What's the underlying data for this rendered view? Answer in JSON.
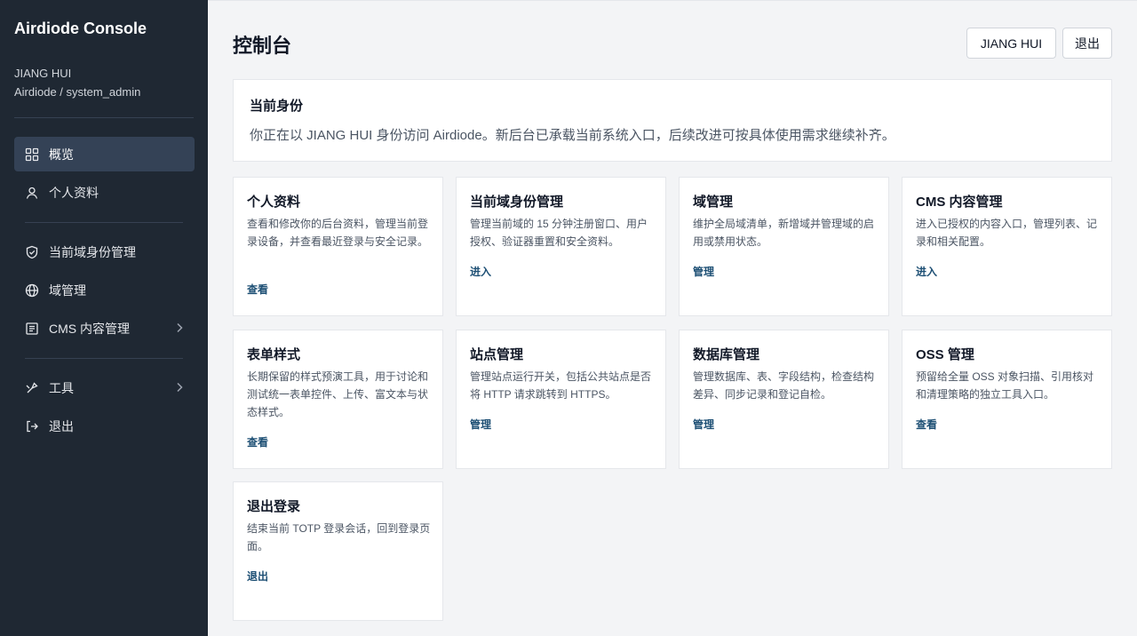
{
  "sidebar": {
    "brand": "Airdiode Console",
    "user_name": "JIANG HUI",
    "user_role": "Airdiode / system_admin",
    "items": [
      {
        "label": "概览",
        "icon": "grid-icon"
      },
      {
        "label": "个人资料",
        "icon": "user-icon"
      },
      {
        "label": "当前域身份管理",
        "icon": "shield-check-icon"
      },
      {
        "label": "域管理",
        "icon": "globe-icon"
      },
      {
        "label": "CMS 内容管理",
        "icon": "document-list-icon"
      },
      {
        "label": "工具",
        "icon": "tools-icon"
      },
      {
        "label": "退出",
        "icon": "logout-icon"
      }
    ]
  },
  "header": {
    "title": "控制台",
    "user_button": "JIANG HUI",
    "logout_button": "退出"
  },
  "identity": {
    "title": "当前身份",
    "text": "你正在以 JIANG HUI 身份访问 Airdiode。新后台已承载当前系统入口，后续改进可按具体使用需求继续补齐。"
  },
  "cards": [
    {
      "title": "个人资料",
      "desc": "查看和修改你的后台资料，管理当前登录设备，并查看最近登录与安全记录。",
      "link": "查看"
    },
    {
      "title": "当前域身份管理",
      "desc": "管理当前域的 15 分钟注册窗口、用户授权、验证器重置和安全资料。",
      "link": "进入"
    },
    {
      "title": "域管理",
      "desc": "维护全局域清单，新增域并管理域的启用或禁用状态。",
      "link": "管理"
    },
    {
      "title": "CMS 内容管理",
      "desc": "进入已授权的内容入口，管理列表、记录和相关配置。",
      "link": "进入"
    },
    {
      "title": "表单样式",
      "desc": "长期保留的样式预演工具，用于讨论和测试统一表单控件、上传、富文本与状态样式。",
      "link": "查看"
    },
    {
      "title": "站点管理",
      "desc": "管理站点运行开关，包括公共站点是否将 HTTP 请求跳转到 HTTPS。",
      "link": "管理"
    },
    {
      "title": "数据库管理",
      "desc": "管理数据库、表、字段结构，检查结构差异、同步记录和登记自检。",
      "link": "管理"
    },
    {
      "title": "OSS 管理",
      "desc": "预留给全量 OSS 对象扫描、引用核对和清理策略的独立工具入口。",
      "link": "查看"
    },
    {
      "title": "退出登录",
      "desc": "结束当前 TOTP 登录会话，回到登录页面。",
      "link": "退出"
    }
  ]
}
